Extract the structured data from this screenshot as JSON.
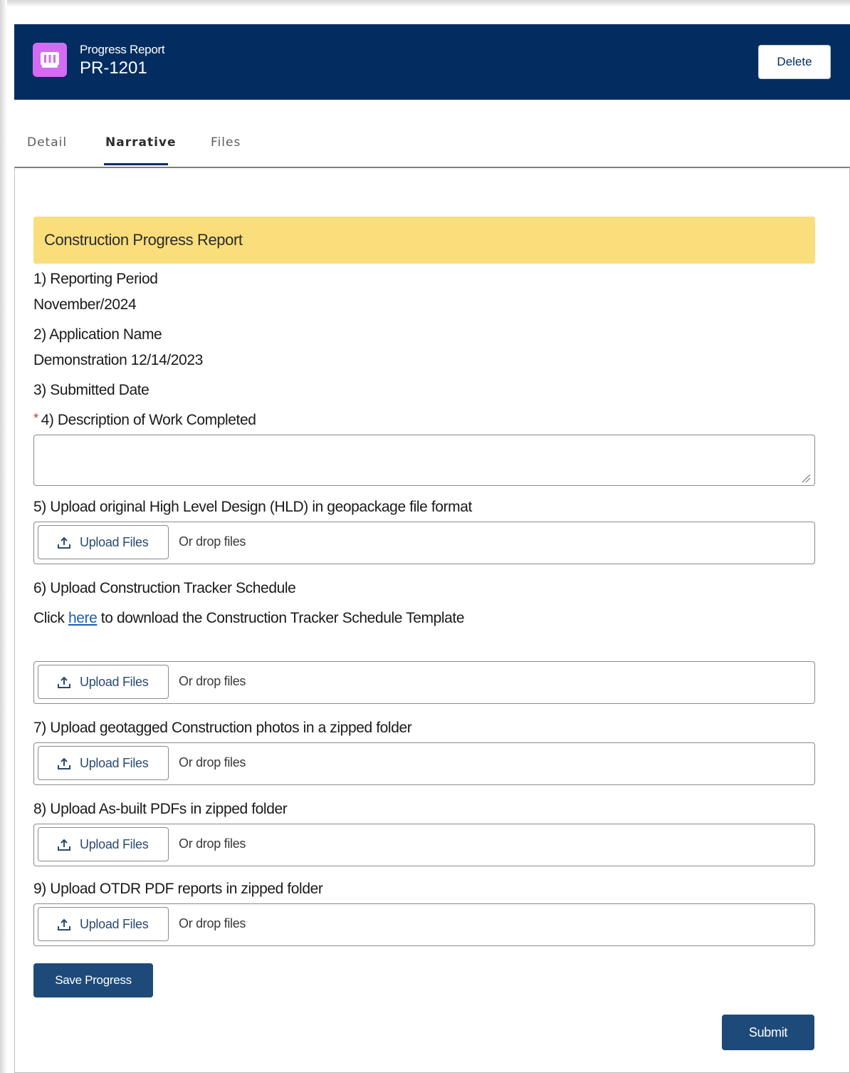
{
  "header": {
    "object_type": "Progress Report",
    "record_name": "PR-1201",
    "delete_label": "Delete",
    "icon": "report-icon",
    "icon_color": "#d36cf2",
    "background": "#032d60"
  },
  "tabs": [
    {
      "label": "Detail",
      "active": false
    },
    {
      "label": "Narrative",
      "active": true
    },
    {
      "label": "Files",
      "active": false
    }
  ],
  "form": {
    "section_title": "Construction Progress Report",
    "q1": {
      "label": "1) Reporting Period",
      "value": "November/2024"
    },
    "q2": {
      "label": "2) Application Name",
      "value": "Demonstration 12/14/2023"
    },
    "q3": {
      "label": "3) Submitted Date",
      "value": ""
    },
    "q4": {
      "required_mark": "*",
      "label": "4) Description of Work Completed",
      "value": ""
    },
    "q5": {
      "label": "5) Upload original High Level Design (HLD) in geopackage file format"
    },
    "q6": {
      "label": "6)  Upload Construction Tracker Schedule",
      "help_prefix": "Click ",
      "help_link": "here",
      "help_suffix": " to download the Construction Tracker Schedule Template"
    },
    "q7": {
      "label": "7) Upload geotagged Construction photos in a zipped folder"
    },
    "q8": {
      "label": "8) Upload As-built PDFs in zipped folder"
    },
    "q9": {
      "label": "9) Upload OTDR PDF reports in zipped folder"
    },
    "upload": {
      "button_label": "Upload Files",
      "drop_label": "Or drop files",
      "icon": "upload-icon"
    },
    "save_label": "Save Progress",
    "submit_label": "Submit"
  },
  "colors": {
    "banner": "#f9de7b",
    "primary_button": "#1e4a79",
    "required": "#c23934",
    "link": "#1b5eb8"
  }
}
